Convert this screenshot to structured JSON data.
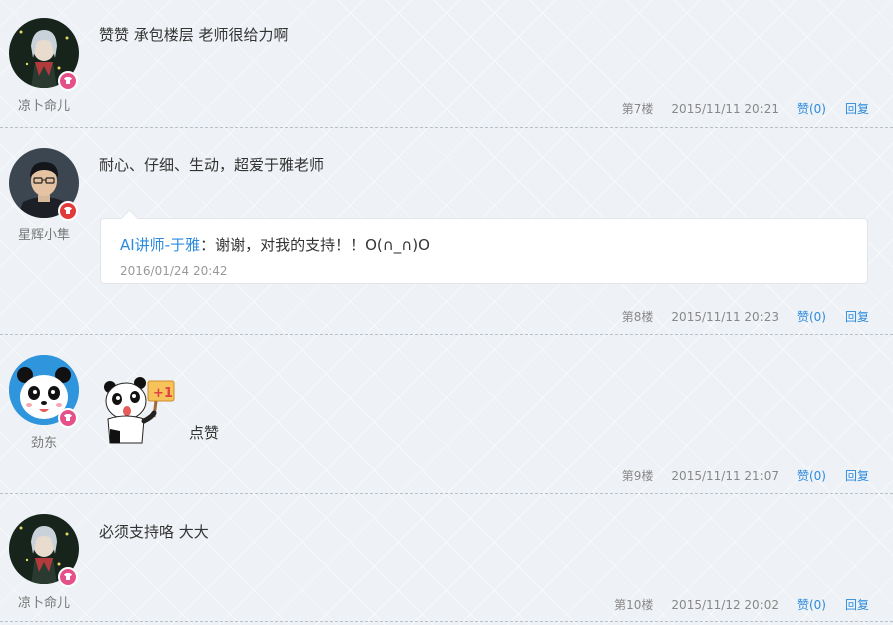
{
  "posts": [
    {
      "username": "凉卜命儿",
      "content": "赞赞  承包楼层  老师很给力啊",
      "floor": "第7楼",
      "time": "2015/11/11 20:21",
      "like": "赞(0)",
      "reply": "回复"
    },
    {
      "username": "星辉小隼",
      "content": "耐心、仔细、生动，超爱于雅老师",
      "floor": "第8楼",
      "time": "2015/11/11 20:23",
      "like": "赞(0)",
      "reply": "回复",
      "teacher_reply": {
        "author": "AI讲师-于雅",
        "text": "：谢谢，对我的支持！！O(∩_∩)O",
        "time": "2016/01/24 20:42"
      }
    },
    {
      "username": "劲东",
      "content": "点赞",
      "sticker_label": "+1",
      "floor": "第9楼",
      "time": "2015/11/11 21:07",
      "like": "赞(0)",
      "reply": "回复"
    },
    {
      "username": "凉卜命儿",
      "content": "必须支持咯  大大",
      "floor": "第10楼",
      "time": "2015/11/12 20:02",
      "like": "赞(0)",
      "reply": "回复"
    }
  ],
  "colors": {
    "link": "#2b8be0",
    "badge_pink": "#e6508a",
    "badge_red": "#e23a3a",
    "avatar_blue": "#2f95dc"
  }
}
